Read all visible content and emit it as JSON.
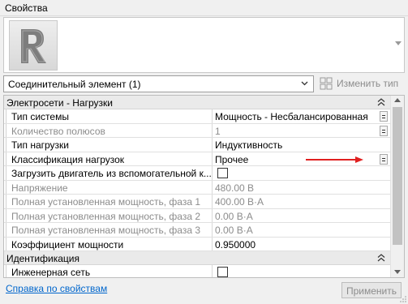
{
  "window": {
    "title": "Свойства"
  },
  "type_selector": {
    "icon": "revit-logo-icon"
  },
  "selector": {
    "selected": "Соединительный элемент (1)",
    "edit_type_label": "Изменить тип"
  },
  "groups": [
    {
      "title": "Электросети - Нагрузки",
      "rows": [
        {
          "name": "Тип системы",
          "value": "Мощность - Несбалансированная",
          "disabled": false,
          "has_button": true
        },
        {
          "name": "Количество полюсов",
          "value": "1",
          "disabled": true,
          "has_button": true
        },
        {
          "name": "Тип нагрузки",
          "value": "Индуктивность",
          "disabled": false,
          "has_button": false
        },
        {
          "name": "Классификация нагрузок",
          "value": "Прочее",
          "disabled": false,
          "has_button": true
        },
        {
          "name": "Загрузить двигатель из вспомогательной к...",
          "value": "",
          "checkbox": true,
          "disabled": false,
          "has_button": false
        },
        {
          "name": "Напряжение",
          "value": "480.00 В",
          "disabled": true,
          "has_button": false
        },
        {
          "name": "Полная установленная мощность, фаза 1",
          "value": "400.00 В·А",
          "disabled": true,
          "has_button": false
        },
        {
          "name": "Полная установленная мощность, фаза 2",
          "value": "0.00 В·А",
          "disabled": true,
          "has_button": false
        },
        {
          "name": "Полная установленная мощность, фаза 3",
          "value": "0.00 В·А",
          "disabled": true,
          "has_button": false
        },
        {
          "name": "Коэффициент мощности",
          "value": "0.950000",
          "disabled": false,
          "has_button": false
        }
      ]
    },
    {
      "title": "Идентификация",
      "rows": [
        {
          "name": "Инженерная сеть",
          "value": "",
          "checkbox": true,
          "disabled": false,
          "has_button": false
        }
      ]
    }
  ],
  "footer": {
    "help_link": "Справка по свойствам",
    "apply_label": "Применить"
  },
  "colors": {
    "link": "#0066cc",
    "annotation_arrow": "#e02020",
    "disabled_text": "#8c8c8c"
  }
}
